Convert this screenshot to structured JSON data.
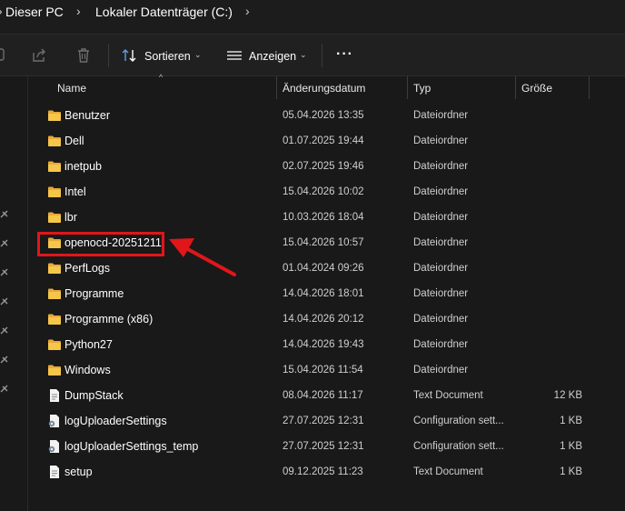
{
  "address_bar": {
    "crumbs": [
      "Dieser PC",
      "Lokaler Datenträger (C:)"
    ]
  },
  "toolbar": {
    "sort_label": "Sortieren",
    "view_label": "Anzeigen",
    "more_label": "···"
  },
  "columns": {
    "name": "Name",
    "date": "Änderungsdatum",
    "type": "Typ",
    "size": "Größe"
  },
  "files": [
    {
      "name": "Benutzer",
      "date": "05.04.2026 13:35",
      "type": "Dateiordner",
      "size": "",
      "icon": "folder-icon"
    },
    {
      "name": "Dell",
      "date": "01.07.2025 19:44",
      "type": "Dateiordner",
      "size": "",
      "icon": "folder-icon"
    },
    {
      "name": "inetpub",
      "date": "02.07.2025 19:46",
      "type": "Dateiordner",
      "size": "",
      "icon": "folder-icon"
    },
    {
      "name": "Intel",
      "date": "15.04.2026 10:02",
      "type": "Dateiordner",
      "size": "",
      "icon": "folder-icon"
    },
    {
      "name": "lbr",
      "date": "10.03.2026 18:04",
      "type": "Dateiordner",
      "size": "",
      "icon": "folder-icon"
    },
    {
      "name": "openocd-20251211",
      "date": "15.04.2026 10:57",
      "type": "Dateiordner",
      "size": "",
      "icon": "folder-icon"
    },
    {
      "name": "PerfLogs",
      "date": "01.04.2024 09:26",
      "type": "Dateiordner",
      "size": "",
      "icon": "folder-icon"
    },
    {
      "name": "Programme",
      "date": "14.04.2026 18:01",
      "type": "Dateiordner",
      "size": "",
      "icon": "folder-icon"
    },
    {
      "name": "Programme (x86)",
      "date": "14.04.2026 20:12",
      "type": "Dateiordner",
      "size": "",
      "icon": "folder-icon"
    },
    {
      "name": "Python27",
      "date": "14.04.2026 19:43",
      "type": "Dateiordner",
      "size": "",
      "icon": "folder-icon"
    },
    {
      "name": "Windows",
      "date": "15.04.2026 11:54",
      "type": "Dateiordner",
      "size": "",
      "icon": "folder-icon"
    },
    {
      "name": "DumpStack",
      "date": "08.04.2026 11:17",
      "type": "Text Document",
      "size": "12 KB",
      "icon": "text-file-icon"
    },
    {
      "name": "logUploaderSettings",
      "date": "27.07.2025 12:31",
      "type": "Configuration sett...",
      "size": "1 KB",
      "icon": "config-file-icon"
    },
    {
      "name": "logUploaderSettings_temp",
      "date": "27.07.2025 12:31",
      "type": "Configuration sett...",
      "size": "1 KB",
      "icon": "config-file-icon"
    },
    {
      "name": "setup",
      "date": "09.12.2025 11:23",
      "type": "Text Document",
      "size": "1 KB",
      "icon": "text-file-icon"
    }
  ],
  "annotation": {
    "highlighted_item": "openocd-20251211",
    "highlight_color": "#e0161b"
  },
  "colors": {
    "background": "#191919",
    "folder": "#f5c64a",
    "annotation_red": "#e0161b"
  }
}
